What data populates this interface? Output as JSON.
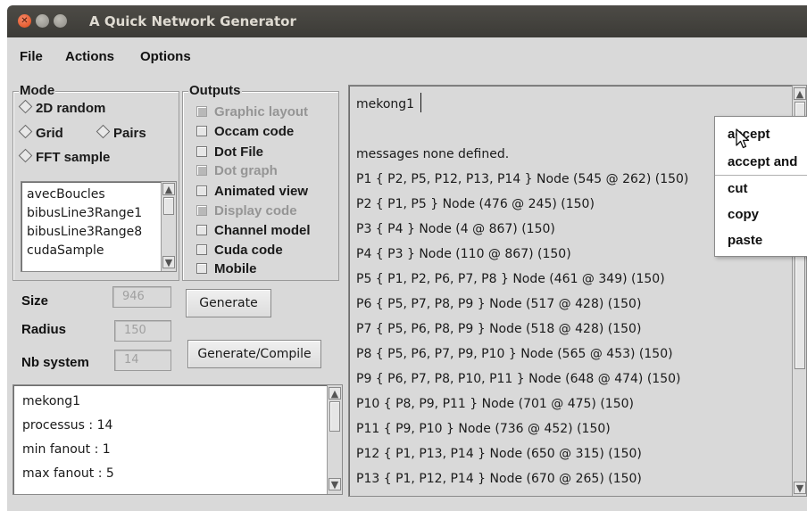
{
  "window": {
    "title": "A Quick Network Generator"
  },
  "menubar": {
    "items": [
      "File",
      "Actions",
      "Options"
    ]
  },
  "mode": {
    "title": "Mode",
    "options": [
      "2D random",
      "Grid",
      "Pairs",
      "FFT sample"
    ],
    "samples": [
      "avecBoucles",
      "bibusLine3Range1",
      "bibusLine3Range8",
      "cudaSample"
    ]
  },
  "outputs": {
    "title": "Outputs",
    "options": [
      {
        "label": "Graphic layout",
        "enabled": false
      },
      {
        "label": "Occam code",
        "enabled": true
      },
      {
        "label": "Dot File",
        "enabled": true
      },
      {
        "label": "Dot graph",
        "enabled": false
      },
      {
        "label": "Animated view",
        "enabled": true
      },
      {
        "label": "Display code",
        "enabled": false
      },
      {
        "label": "Channel model",
        "enabled": true
      },
      {
        "label": "Cuda code",
        "enabled": true
      },
      {
        "label": "Mobile",
        "enabled": true
      }
    ]
  },
  "params": {
    "size_label": "Size",
    "size_value": "946",
    "radius_label": "Radius",
    "radius_value": "150",
    "nb_label": "Nb system",
    "nb_value": "14"
  },
  "buttons": {
    "generate": "Generate",
    "generate_compile": "Generate/Compile"
  },
  "summary": {
    "lines": [
      "mekong1",
      "processus : 14",
      "min fanout : 1",
      "max fanout : 5"
    ]
  },
  "output": {
    "input_text": "mekong1",
    "lines": [
      "messages none  defined.",
      "P1 { P2, P5, P12, P13, P14 } Node (545 @ 262) (150)",
      "P2 { P1, P5 } Node (476 @ 245) (150)",
      "P3 { P4 } Node (4 @ 867) (150)",
      "P4 { P3 } Node (110 @ 867) (150)",
      "P5 { P1, P2, P6, P7, P8 } Node (461 @ 349) (150)",
      "P6 { P5, P7, P8, P9 } Node (517 @ 428) (150)",
      "P7 { P5, P6, P8, P9 } Node (518 @ 428) (150)",
      "P8 { P5, P6, P7, P9, P10 } Node (565 @ 453) (150)",
      "P9 { P6, P7, P8, P10, P11 } Node (648 @ 474) (150)",
      "P10 { P8, P9, P11 } Node (701 @ 475) (150)",
      "P11 { P9, P10 } Node (736 @ 452) (150)",
      "P12 { P1, P13, P14 } Node (650 @ 315) (150)",
      "P13 { P1, P12, P14 } Node (670 @ 265) (150)"
    ]
  },
  "context_menu": {
    "items": [
      "accept",
      "accept and",
      "cut",
      "copy",
      "paste"
    ]
  }
}
